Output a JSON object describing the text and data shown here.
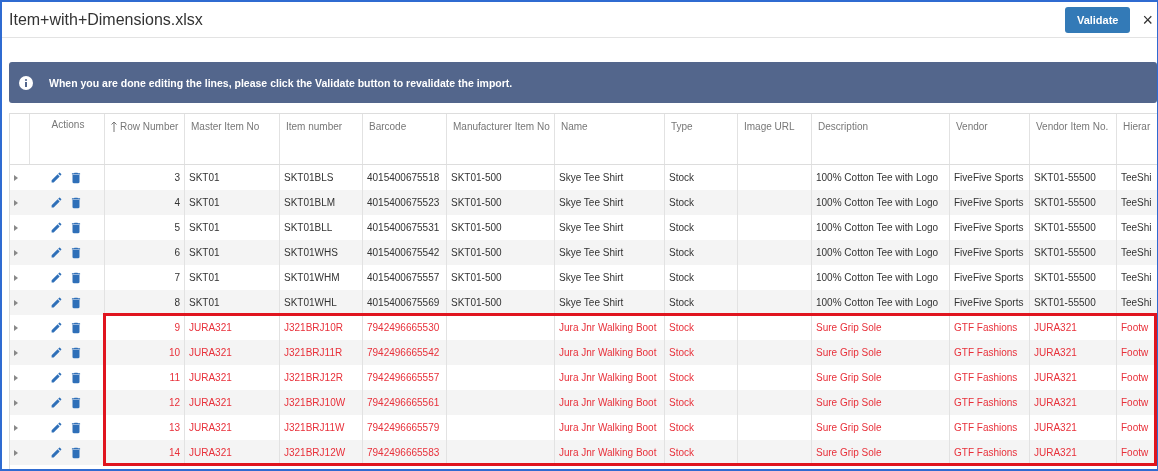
{
  "window": {
    "title": "Item+with+Dimensions.xlsx",
    "close": "×"
  },
  "toolbar": {
    "validate_button": "Validate"
  },
  "info_banner": {
    "text": "When you are done editing the lines, please click the Validate button to revalidate the import."
  },
  "table": {
    "columns": [
      {
        "sorted": false
      },
      {
        "label": "Actions",
        "sorted": false
      },
      {
        "label": "Row Number",
        "sorted": true
      },
      {
        "label": "Master Item No",
        "sorted": false
      },
      {
        "label": "Item number",
        "sorted": false
      },
      {
        "label": "Barcode",
        "sorted": false
      },
      {
        "label": "Manufacturer Item No",
        "sorted": false
      },
      {
        "label": "Name",
        "sorted": false
      },
      {
        "label": "Type",
        "sorted": false
      },
      {
        "label": "Image URL",
        "sorted": false
      },
      {
        "label": "Description",
        "sorted": false
      },
      {
        "label": "Vendor",
        "sorted": false
      },
      {
        "label": "Vendor Item No.",
        "sorted": false
      },
      {
        "label": "Hierar",
        "sorted": false
      }
    ],
    "rows": [
      {
        "row_number": "3",
        "master_item_no": "SKT01",
        "item_number": "SKT01BLS",
        "barcode": "4015400675518",
        "manufacturer_item_no": "SKT01-500",
        "name": "Skye Tee Shirt",
        "type": "Stock",
        "description": "100% Cotton Tee with Logo",
        "vendor": "FiveFive Sports",
        "vendor_item_no": "SKT01-55500",
        "hierarchy": "TeeShi",
        "error": false
      },
      {
        "row_number": "4",
        "master_item_no": "SKT01",
        "item_number": "SKT01BLM",
        "barcode": "4015400675523",
        "manufacturer_item_no": "SKT01-500",
        "name": "Skye Tee Shirt",
        "type": "Stock",
        "description": "100% Cotton Tee with Logo",
        "vendor": "FiveFive Sports",
        "vendor_item_no": "SKT01-55500",
        "hierarchy": "TeeShi",
        "error": false
      },
      {
        "row_number": "5",
        "master_item_no": "SKT01",
        "item_number": "SKT01BLL",
        "barcode": "4015400675531",
        "manufacturer_item_no": "SKT01-500",
        "name": "Skye Tee Shirt",
        "type": "Stock",
        "description": "100% Cotton Tee with Logo",
        "vendor": "FiveFive Sports",
        "vendor_item_no": "SKT01-55500",
        "hierarchy": "TeeShi",
        "error": false
      },
      {
        "row_number": "6",
        "master_item_no": "SKT01",
        "item_number": "SKT01WHS",
        "barcode": "4015400675542",
        "manufacturer_item_no": "SKT01-500",
        "name": "Skye Tee Shirt",
        "type": "Stock",
        "description": "100% Cotton Tee with Logo",
        "vendor": "FiveFive Sports",
        "vendor_item_no": "SKT01-55500",
        "hierarchy": "TeeShi",
        "error": false
      },
      {
        "row_number": "7",
        "master_item_no": "SKT01",
        "item_number": "SKT01WHM",
        "barcode": "4015400675557",
        "manufacturer_item_no": "SKT01-500",
        "name": "Skye Tee Shirt",
        "type": "Stock",
        "description": "100% Cotton Tee with Logo",
        "vendor": "FiveFive Sports",
        "vendor_item_no": "SKT01-55500",
        "hierarchy": "TeeShi",
        "error": false
      },
      {
        "row_number": "8",
        "master_item_no": "SKT01",
        "item_number": "SKT01WHL",
        "barcode": "4015400675569",
        "manufacturer_item_no": "SKT01-500",
        "name": "Skye Tee Shirt",
        "type": "Stock",
        "description": "100% Cotton Tee with Logo",
        "vendor": "FiveFive Sports",
        "vendor_item_no": "SKT01-55500",
        "hierarchy": "TeeShi",
        "error": false
      },
      {
        "row_number": "9",
        "master_item_no": "JURA321",
        "item_number": "J321BRJ10R",
        "barcode": "7942496665530",
        "name": "Jura Jnr Walking Boot",
        "type": "Stock",
        "description": "Sure Grip Sole",
        "vendor": "GTF Fashions",
        "vendor_item_no": "JURA321",
        "hierarchy": "Footw",
        "error": true
      },
      {
        "row_number": "10",
        "master_item_no": "JURA321",
        "item_number": "J321BRJ11R",
        "barcode": "7942496665542",
        "name": "Jura Jnr Walking Boot",
        "type": "Stock",
        "description": "Sure Grip Sole",
        "vendor": "GTF Fashions",
        "vendor_item_no": "JURA321",
        "hierarchy": "Footw",
        "error": true
      },
      {
        "row_number": "11",
        "master_item_no": "JURA321",
        "item_number": "J321BRJ12R",
        "barcode": "7942496665557",
        "name": "Jura Jnr Walking Boot",
        "type": "Stock",
        "description": "Sure Grip Sole",
        "vendor": "GTF Fashions",
        "vendor_item_no": "JURA321",
        "hierarchy": "Footw",
        "error": true
      },
      {
        "row_number": "12",
        "master_item_no": "JURA321",
        "item_number": "J321BRJ10W",
        "barcode": "7942496665561",
        "name": "Jura Jnr Walking Boot",
        "type": "Stock",
        "description": "Sure Grip Sole",
        "vendor": "GTF Fashions",
        "vendor_item_no": "JURA321",
        "hierarchy": "Footw",
        "error": true
      },
      {
        "row_number": "13",
        "master_item_no": "JURA321",
        "item_number": "J321BRJ11W",
        "barcode": "7942496665579",
        "name": "Jura Jnr Walking Boot",
        "type": "Stock",
        "description": "Sure Grip Sole",
        "vendor": "GTF Fashions",
        "vendor_item_no": "JURA321",
        "hierarchy": "Footw",
        "error": true
      },
      {
        "row_number": "14",
        "master_item_no": "JURA321",
        "item_number": "J321BRJ12W",
        "barcode": "7942496665583",
        "name": "Jura Jnr Walking Boot",
        "type": "Stock",
        "description": "Sure Grip Sole",
        "vendor": "GTF Fashions",
        "vendor_item_no": "JURA321",
        "hierarchy": "Footw",
        "error": true
      }
    ]
  }
}
